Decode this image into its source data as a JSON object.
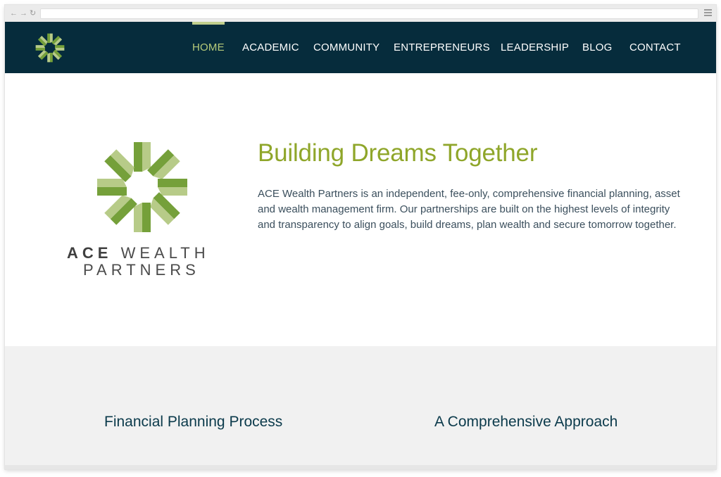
{
  "nav": {
    "items": [
      {
        "label": "HOME",
        "active": true
      },
      {
        "label": "ACADEMIC",
        "active": false
      },
      {
        "label": "COMMUNITY",
        "active": false
      },
      {
        "label": "ENTREPRENEURS",
        "active": false
      },
      {
        "label": "LEADERSHIP",
        "active": false
      },
      {
        "label": "BLOG",
        "active": false
      },
      {
        "label": "CONTACT",
        "active": false
      }
    ]
  },
  "hero": {
    "brand": {
      "first": "ACE",
      "second": "WEALTH",
      "third": "PARTNERS"
    },
    "title": "Building Dreams Together",
    "description": "ACE Wealth Partners is an independent, fee-only, comprehensive financial planning, asset and wealth management firm. Our partnerships are built on the highest levels of integrity and transparency to align goals, build dreams, plan wealth and secure tomorrow together."
  },
  "features": {
    "left_title": "Financial Planning Process",
    "right_title": "A Comprehensive Approach"
  },
  "colors": {
    "header_bg": "#062c3c",
    "accent_green": "#8fa62a",
    "logo_dark_green": "#75a03a",
    "logo_light_green": "#b7cb88",
    "section_gray": "#f1f1f1"
  },
  "icons": {
    "back": "back-arrow-icon",
    "forward": "forward-arrow-icon",
    "reload": "reload-icon",
    "menu": "hamburger-menu-icon",
    "logo": "ace-star-logo-icon"
  }
}
